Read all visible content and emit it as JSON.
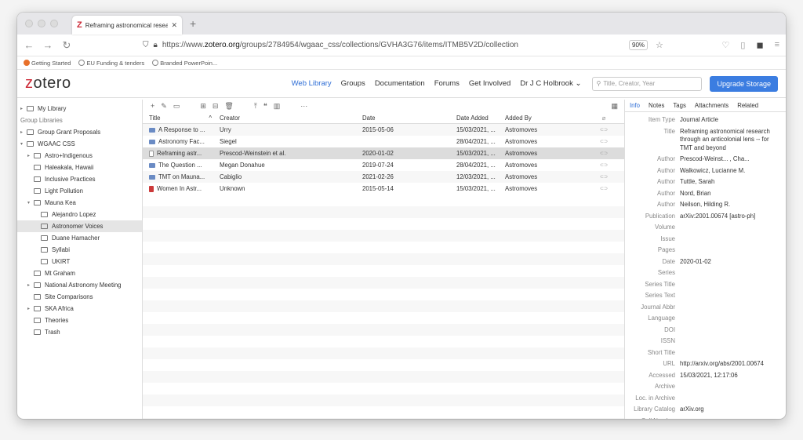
{
  "browser": {
    "tab_title": "Reframing astronomical researc",
    "url_prefix": "https://www.",
    "url_domain": "zotero.org",
    "url_rest": "/groups/2784954/wgaac_css/collections/GVHA3G76/items/ITMB5V2D/collection",
    "zoom": "90%",
    "bookmarks": [
      "Getting Started",
      "EU Funding & tenders",
      "Branded PowerPoin..."
    ]
  },
  "zotero": {
    "logo_z": "z",
    "logo_rest": "otero",
    "nav": [
      "Web Library",
      "Groups",
      "Documentation",
      "Forums",
      "Get Involved",
      "Dr J C Holbrook"
    ],
    "search_placeholder": "Title, Creator, Year",
    "upgrade": "Upgrade Storage"
  },
  "sidebar": [
    {
      "label": "My Library",
      "indent": 0,
      "tw": "▸"
    },
    {
      "label": "Group Libraries",
      "indent": 0,
      "tw": "",
      "header": true
    },
    {
      "label": "Group Grant Proposals",
      "indent": 0,
      "tw": "▸"
    },
    {
      "label": "WGAAC CSS",
      "indent": 0,
      "tw": "▾"
    },
    {
      "label": "Astro+Indigenous",
      "indent": 1,
      "tw": "▸"
    },
    {
      "label": "Haleakala, Hawaii",
      "indent": 1,
      "tw": ""
    },
    {
      "label": "Inclusive Practices",
      "indent": 1,
      "tw": ""
    },
    {
      "label": "Light Pollution",
      "indent": 1,
      "tw": ""
    },
    {
      "label": "Mauna Kea",
      "indent": 1,
      "tw": "▾"
    },
    {
      "label": "Alejandro Lopez",
      "indent": 2,
      "tw": ""
    },
    {
      "label": "Astronomer Voices",
      "indent": 2,
      "tw": "",
      "selected": true
    },
    {
      "label": "Duane Hamacher",
      "indent": 2,
      "tw": ""
    },
    {
      "label": "Syllabi",
      "indent": 2,
      "tw": ""
    },
    {
      "label": "UKIRT",
      "indent": 2,
      "tw": ""
    },
    {
      "label": "Mt Graham",
      "indent": 1,
      "tw": ""
    },
    {
      "label": "National Astronomy Meeting",
      "indent": 1,
      "tw": "▸"
    },
    {
      "label": "Site Comparisons",
      "indent": 1,
      "tw": ""
    },
    {
      "label": "SKA Africa",
      "indent": 1,
      "tw": "▸"
    },
    {
      "label": "Theories",
      "indent": 1,
      "tw": ""
    },
    {
      "label": "Trash",
      "indent": 1,
      "tw": ""
    }
  ],
  "table": {
    "headers": {
      "title": "Title",
      "creator": "Creator",
      "date": "Date",
      "added": "Date Added",
      "by": "Added By"
    },
    "rows": [
      {
        "title": "A Response to ...",
        "creator": "Urry",
        "date": "2015-05-06",
        "added": "15/03/2021, ...",
        "by": "Astromoves",
        "icon": "doc"
      },
      {
        "title": "Astronomy Fac...",
        "creator": "Siegel",
        "date": "",
        "added": "28/04/2021, ...",
        "by": "Astromoves",
        "icon": "doc"
      },
      {
        "title": "Reframing astr...",
        "creator": "Prescod-Weinstein et al.",
        "date": "2020-01-02",
        "added": "15/03/2021, ...",
        "by": "Astromoves",
        "icon": "gen",
        "selected": true
      },
      {
        "title": "The Question ...",
        "creator": "Megan Donahue",
        "date": "2019-07-24",
        "added": "28/04/2021, ...",
        "by": "Astromoves",
        "icon": "doc"
      },
      {
        "title": "TMT on Mauna...",
        "creator": "Cabiglio",
        "date": "2021-02-26",
        "added": "12/03/2021, ...",
        "by": "Astromoves",
        "icon": "doc"
      },
      {
        "title": "Women In Astr...",
        "creator": "Unknown",
        "date": "2015-05-14",
        "added": "15/03/2021, ...",
        "by": "Astromoves",
        "icon": "rep"
      }
    ]
  },
  "details": {
    "tabs": [
      "Info",
      "Notes",
      "Tags",
      "Attachments",
      "Related"
    ],
    "fields": [
      {
        "label": "Item Type",
        "value": "Journal Article"
      },
      {
        "label": "Title",
        "value": "Reframing astronomical research through an anticolonial lens -- for TMT and beyond"
      },
      {
        "label": "Author",
        "value": "Prescod-Weinst... , Cha..."
      },
      {
        "label": "Author",
        "value": "Walkowicz, Lucianne M."
      },
      {
        "label": "Author",
        "value": "Tuttle, Sarah"
      },
      {
        "label": "Author",
        "value": "Nord, Brian"
      },
      {
        "label": "Author",
        "value": "Neilson, Hilding R."
      },
      {
        "label": "Publication",
        "value": "arXiv:2001.00674 [astro-ph]"
      },
      {
        "label": "Volume",
        "value": ""
      },
      {
        "label": "Issue",
        "value": ""
      },
      {
        "label": "Pages",
        "value": ""
      },
      {
        "label": "Date",
        "value": "2020-01-02"
      },
      {
        "label": "Series",
        "value": ""
      },
      {
        "label": "Series Title",
        "value": ""
      },
      {
        "label": "Series Text",
        "value": ""
      },
      {
        "label": "Journal Abbr",
        "value": ""
      },
      {
        "label": "Language",
        "value": ""
      },
      {
        "label": "DOI",
        "value": ""
      },
      {
        "label": "ISSN",
        "value": ""
      },
      {
        "label": "Short Title",
        "value": ""
      },
      {
        "label": "URL",
        "value": "http://arxiv.org/abs/2001.00674"
      },
      {
        "label": "Accessed",
        "value": "15/03/2021, 12:17:06"
      },
      {
        "label": "Archive",
        "value": ""
      },
      {
        "label": "Loc. in Archive",
        "value": ""
      },
      {
        "label": "Library Catalog",
        "value": "arXiv.org"
      },
      {
        "label": "Call Number",
        "value": ""
      }
    ]
  }
}
